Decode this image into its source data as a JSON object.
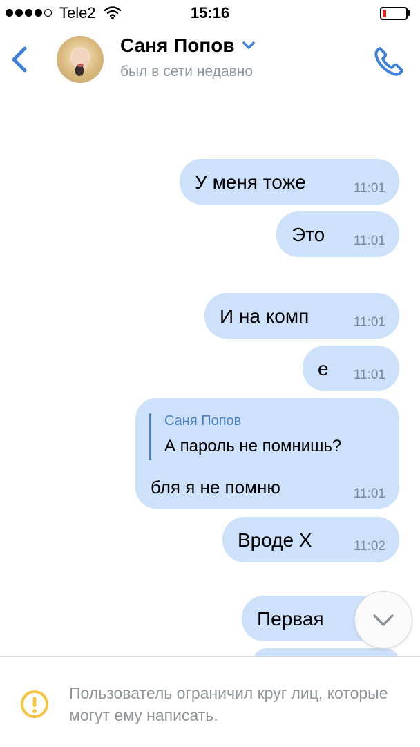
{
  "status_bar": {
    "carrier": "Tele2",
    "time": "15:16",
    "signal_bars": 4,
    "signal_max": 5,
    "battery_level": 0.1,
    "battery_color": "#e02020"
  },
  "header": {
    "contact_name": "Саня Попов",
    "status": "был в сети недавно",
    "accent": "#3f80d9",
    "icons": [
      "back-chevron-icon",
      "dropdown-chevron-icon",
      "phone-icon"
    ]
  },
  "messages": [
    {
      "text": "У меня тоже",
      "time": "11:01"
    },
    {
      "text": "Это",
      "time": "11:01"
    },
    {
      "text": "И на комп",
      "time": "11:01"
    },
    {
      "text": "е",
      "time": "11:01"
    },
    {
      "text": "бля я не помню",
      "time": "11:01",
      "reply": {
        "name": "Саня Попов",
        "text": "А пароль не помнишь?"
      }
    },
    {
      "text": "Вроде Х",
      "time": "11:02"
    },
    {
      "text": "Первая",
      "time": ""
    }
  ],
  "bubble_color": "#cde1fb",
  "footer": {
    "notice": "Пользователь ограничил круг лиц, которые могут ему написать.",
    "icon": "warning-circle-icon",
    "icon_color": "#f5c542"
  }
}
